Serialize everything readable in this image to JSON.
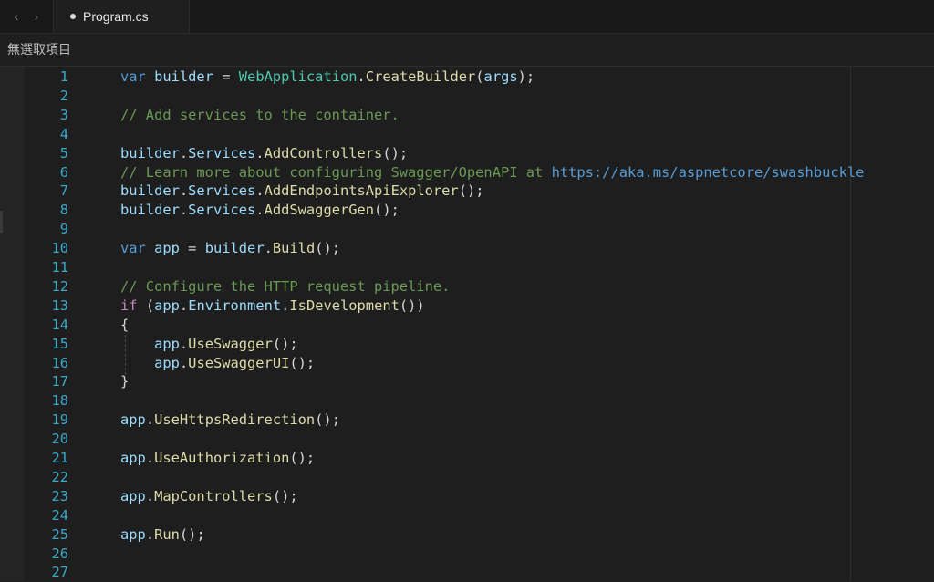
{
  "tabbar": {
    "back_icon": "chevron-left-icon",
    "forward_icon": "chevron-right-icon",
    "back_glyph": "‹",
    "forward_glyph": "›",
    "active_tab": {
      "filename": "Program.cs",
      "modified": true
    }
  },
  "breadcrumb": "無選取項目",
  "editor": {
    "language": "C#",
    "line_numbers": [
      "1",
      "2",
      "3",
      "4",
      "5",
      "6",
      "7",
      "8",
      "9",
      "10",
      "11",
      "12",
      "13",
      "14",
      "15",
      "16",
      "17",
      "18",
      "19",
      "20",
      "21",
      "22",
      "23",
      "24",
      "25",
      "26",
      "27"
    ],
    "lines": [
      [
        {
          "t": "var",
          "c": "kw"
        },
        {
          "t": " "
        },
        {
          "t": "builder",
          "c": "var"
        },
        {
          "t": " = "
        },
        {
          "t": "WebApplication",
          "c": "type"
        },
        {
          "t": "."
        },
        {
          "t": "CreateBuilder",
          "c": "fn"
        },
        {
          "t": "("
        },
        {
          "t": "args",
          "c": "var"
        },
        {
          "t": ");"
        }
      ],
      [],
      [
        {
          "t": "// Add services to the container.",
          "c": "cm"
        }
      ],
      [],
      [
        {
          "t": "builder",
          "c": "var"
        },
        {
          "t": "."
        },
        {
          "t": "Services",
          "c": "var"
        },
        {
          "t": "."
        },
        {
          "t": "AddControllers",
          "c": "fn"
        },
        {
          "t": "();"
        }
      ],
      [
        {
          "t": "// Learn more about configuring Swagger/OpenAPI at ",
          "c": "cm"
        },
        {
          "t": "https://aka.ms/aspnetcore/swashbuckle",
          "c": "url"
        }
      ],
      [
        {
          "t": "builder",
          "c": "var"
        },
        {
          "t": "."
        },
        {
          "t": "Services",
          "c": "var"
        },
        {
          "t": "."
        },
        {
          "t": "AddEndpointsApiExplorer",
          "c": "fn"
        },
        {
          "t": "();"
        }
      ],
      [
        {
          "t": "builder",
          "c": "var"
        },
        {
          "t": "."
        },
        {
          "t": "Services",
          "c": "var"
        },
        {
          "t": "."
        },
        {
          "t": "AddSwaggerGen",
          "c": "fn"
        },
        {
          "t": "();"
        }
      ],
      [],
      [
        {
          "t": "var",
          "c": "kw"
        },
        {
          "t": " "
        },
        {
          "t": "app",
          "c": "var"
        },
        {
          "t": " = "
        },
        {
          "t": "builder",
          "c": "var"
        },
        {
          "t": "."
        },
        {
          "t": "Build",
          "c": "fn"
        },
        {
          "t": "();"
        }
      ],
      [],
      [
        {
          "t": "// Configure the HTTP request pipeline.",
          "c": "cm"
        }
      ],
      [
        {
          "t": "if",
          "c": "kw2"
        },
        {
          "t": " ("
        },
        {
          "t": "app",
          "c": "var"
        },
        {
          "t": "."
        },
        {
          "t": "Environment",
          "c": "var"
        },
        {
          "t": "."
        },
        {
          "t": "IsDevelopment",
          "c": "fn"
        },
        {
          "t": "())"
        }
      ],
      [
        {
          "t": "{"
        }
      ],
      [
        {
          "t": "    "
        },
        {
          "t": "app",
          "c": "var"
        },
        {
          "t": "."
        },
        {
          "t": "UseSwagger",
          "c": "fn"
        },
        {
          "t": "();"
        }
      ],
      [
        {
          "t": "    "
        },
        {
          "t": "app",
          "c": "var"
        },
        {
          "t": "."
        },
        {
          "t": "UseSwaggerUI",
          "c": "fn"
        },
        {
          "t": "();"
        }
      ],
      [
        {
          "t": "}"
        }
      ],
      [],
      [
        {
          "t": "app",
          "c": "var"
        },
        {
          "t": "."
        },
        {
          "t": "UseHttpsRedirection",
          "c": "fn"
        },
        {
          "t": "();"
        }
      ],
      [],
      [
        {
          "t": "app",
          "c": "var"
        },
        {
          "t": "."
        },
        {
          "t": "UseAuthorization",
          "c": "fn"
        },
        {
          "t": "();"
        }
      ],
      [],
      [
        {
          "t": "app",
          "c": "var"
        },
        {
          "t": "."
        },
        {
          "t": "MapControllers",
          "c": "fn"
        },
        {
          "t": "();"
        }
      ],
      [],
      [
        {
          "t": "app",
          "c": "var"
        },
        {
          "t": "."
        },
        {
          "t": "Run",
          "c": "fn"
        },
        {
          "t": "();"
        }
      ],
      [],
      []
    ]
  },
  "colors": {
    "background": "#1e1e1e",
    "line_number": "#3aa8c8",
    "keyword": "#569cd6",
    "control_keyword": "#c586c0",
    "identifier": "#9cdcfe",
    "type": "#4ec9b0",
    "method": "#dcdcaa",
    "comment": "#6a9955",
    "plain": "#d4d4d4"
  }
}
